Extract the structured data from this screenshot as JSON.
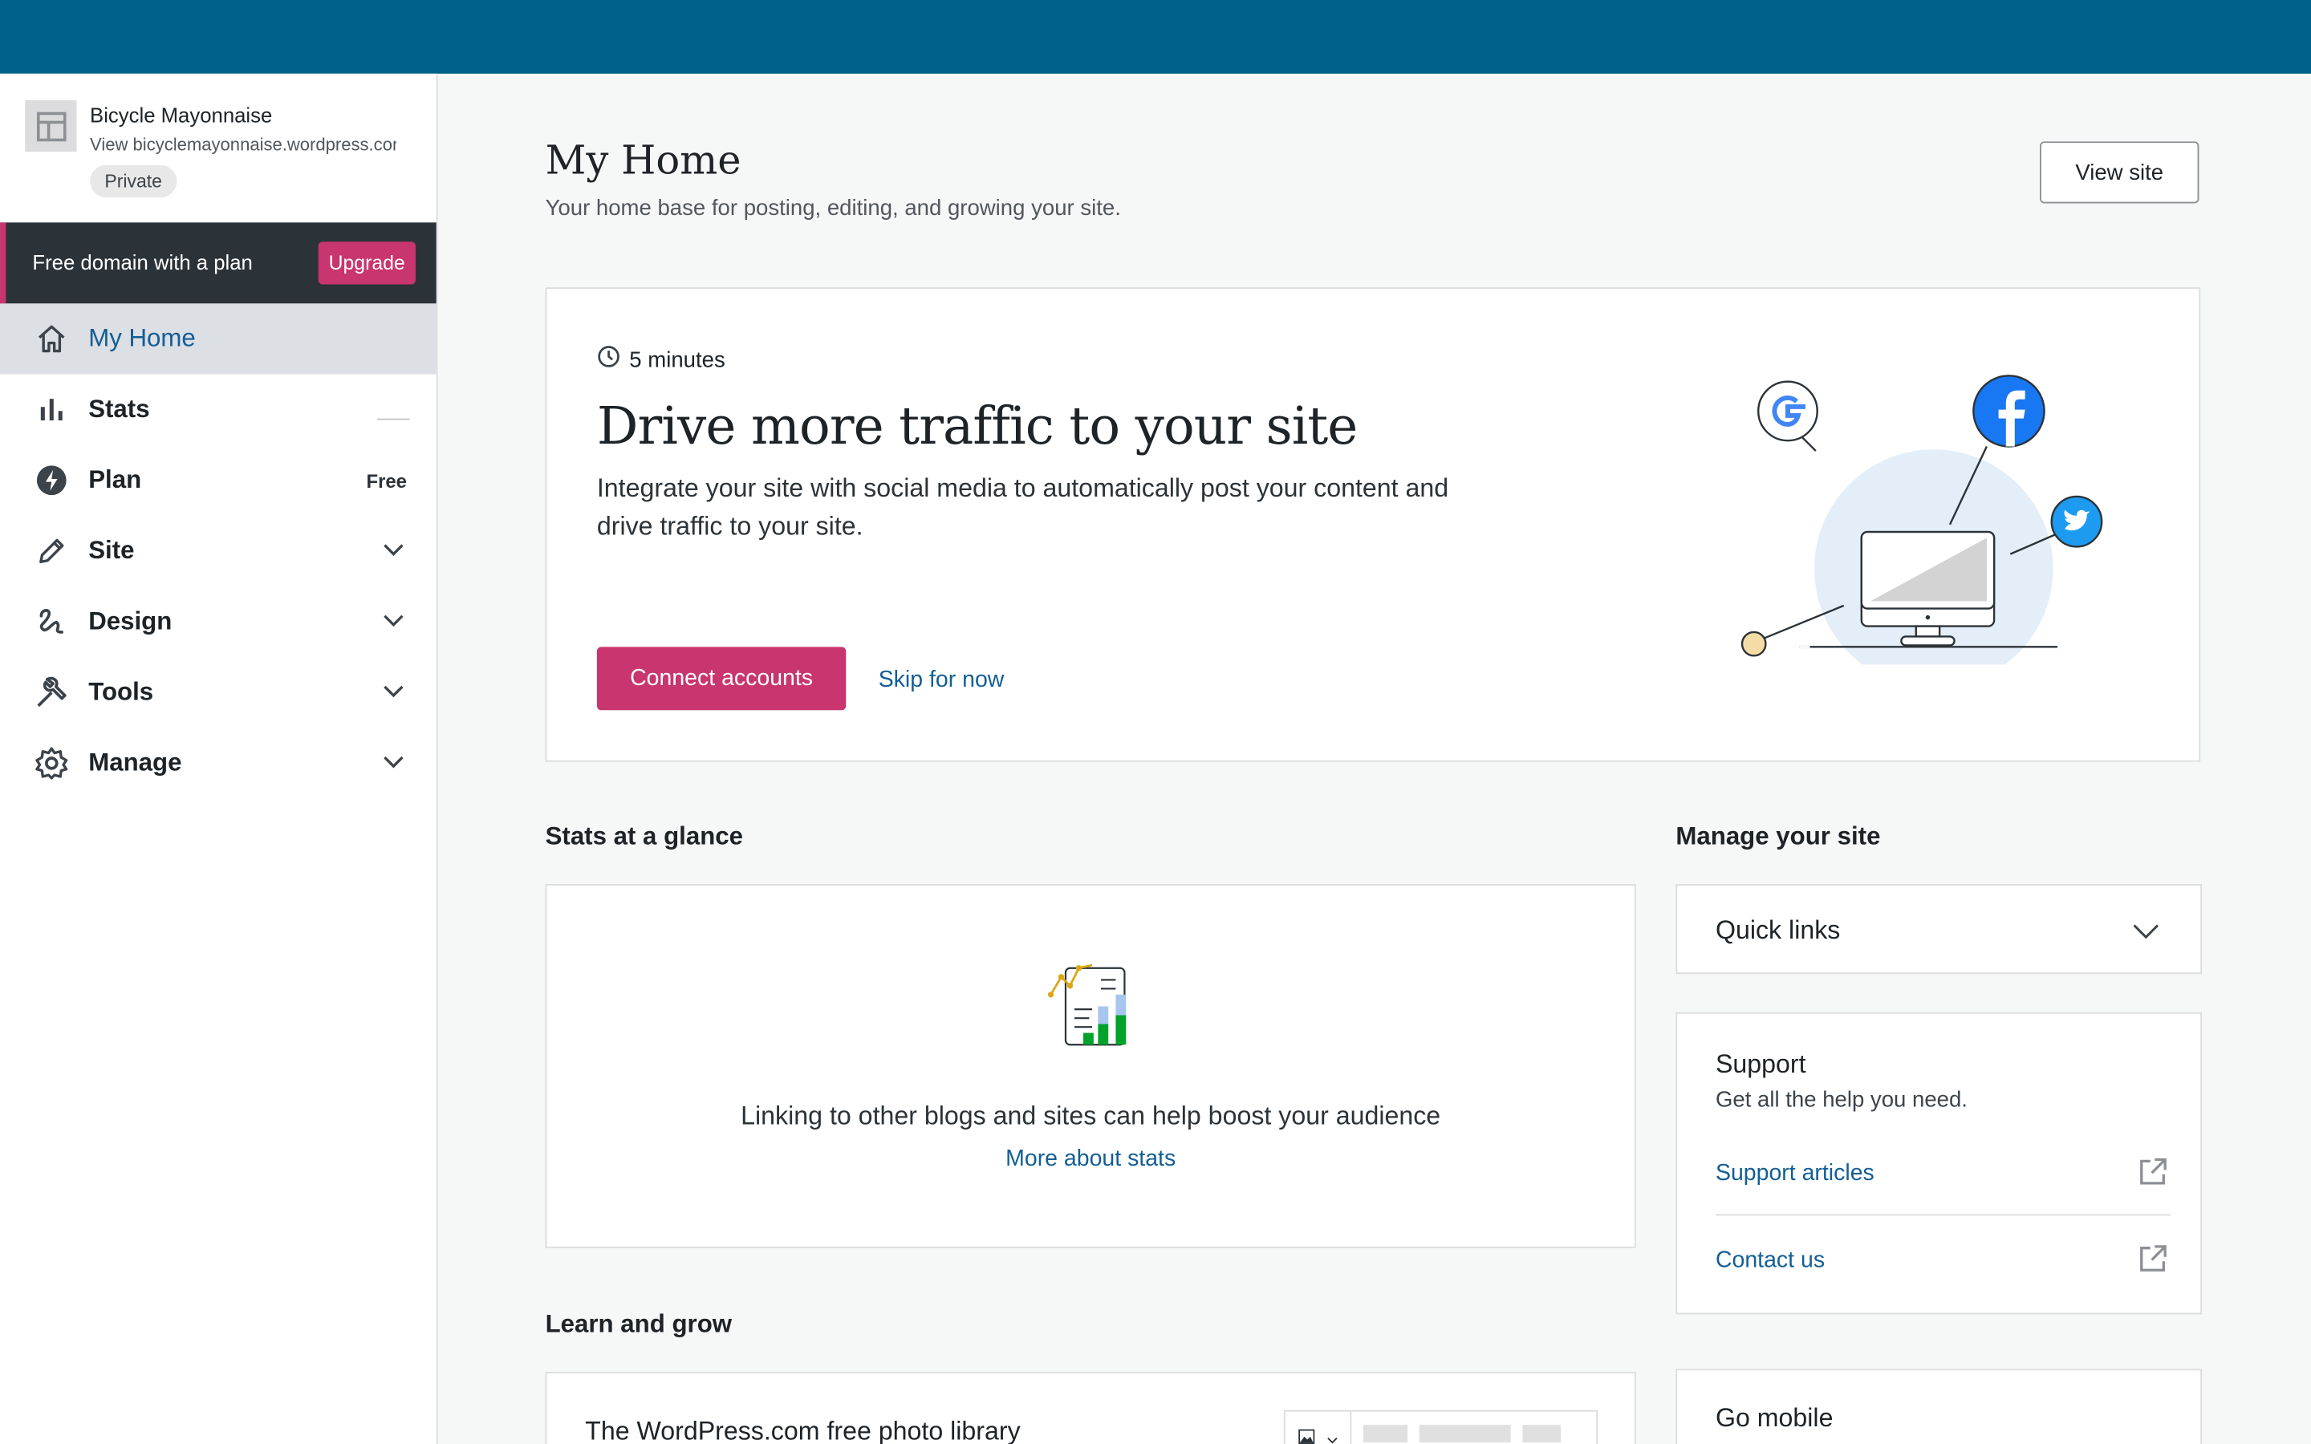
{
  "sidebar": {
    "site_name": "Bicycle Mayonnaise",
    "site_url": "View bicyclemayonnaise.wordpress.com",
    "site_badge": "Private",
    "upsell_text": "Free domain with a plan",
    "upsell_button": "Upgrade",
    "items": [
      {
        "label": "My Home",
        "icon": "home-icon"
      },
      {
        "label": "Stats",
        "icon": "stats-icon"
      },
      {
        "label": "Plan",
        "icon": "plan-icon",
        "badge": "Free"
      },
      {
        "label": "Site",
        "icon": "pencil-icon"
      },
      {
        "label": "Design",
        "icon": "design-icon"
      },
      {
        "label": "Tools",
        "icon": "wrench-icon"
      },
      {
        "label": "Manage",
        "icon": "gear-icon"
      }
    ]
  },
  "header": {
    "title": "My Home",
    "subtitle": "Your home base for posting, editing, and growing your site.",
    "view_site_button": "View site"
  },
  "hero": {
    "time": "5 minutes",
    "title": "Drive more traffic to your site",
    "description": "Integrate your site with social media to automatically post your content and drive traffic to your site.",
    "primary_button": "Connect accounts",
    "secondary_link": "Skip for now"
  },
  "stats": {
    "section_title": "Stats at a glance",
    "message": "Linking to other blogs and sites can help boost your audience",
    "link": "More about stats"
  },
  "manage": {
    "section_title": "Manage your site",
    "quick_links": "Quick links",
    "support_title": "Support",
    "support_subtitle": "Get all the help you need.",
    "support_articles": "Support articles",
    "contact_us": "Contact us"
  },
  "learn": {
    "section_title": "Learn and grow",
    "photo_card_title": "The WordPress.com free photo library",
    "go_mobile": "Go mobile"
  },
  "colors": {
    "topbar": "#00628b",
    "accent_pink": "#c9356e",
    "link_blue": "#135e96"
  }
}
